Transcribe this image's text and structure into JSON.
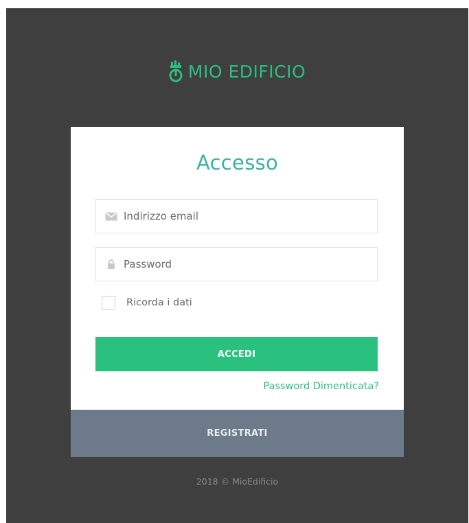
{
  "brand": {
    "name": "MIO EDIFICIO",
    "icon": "building-logo-icon",
    "accent_color": "#2bbf7e"
  },
  "login": {
    "title": "Accesso",
    "email": {
      "placeholder": "Indirizzo email",
      "value": "",
      "icon": "envelope-icon"
    },
    "password": {
      "placeholder": "Password",
      "value": "",
      "icon": "lock-icon"
    },
    "remember": {
      "label": "Ricorda i dati",
      "checked": false
    },
    "submit_label": "ACCEDI",
    "forgot_label": "Password Dimenticata?",
    "submit_color": "#2ac07e"
  },
  "register": {
    "label": "REGISTRATI",
    "color": "#6c7a89"
  },
  "footer": {
    "text": "2018 © MioEdificio"
  }
}
